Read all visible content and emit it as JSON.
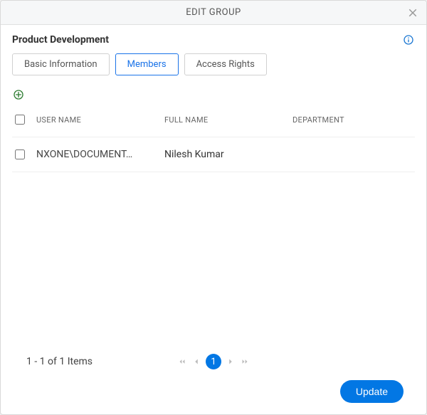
{
  "dialog": {
    "title": "EDIT GROUP",
    "group_name": "Product Development"
  },
  "tabs": [
    {
      "label": "Basic Information",
      "active": false
    },
    {
      "label": "Members",
      "active": true
    },
    {
      "label": "Access Rights",
      "active": false
    }
  ],
  "table": {
    "headers": {
      "username": "USER NAME",
      "fullname": "FULL NAME",
      "department": "DEPARTMENT"
    },
    "rows": [
      {
        "username": "NXONE\\DOCUMENT…",
        "fullname": "Nilesh Kumar",
        "department": ""
      }
    ]
  },
  "pager": {
    "status": "1 - 1 of 1 Items",
    "current_page": "1"
  },
  "footer": {
    "update_label": "Update"
  }
}
